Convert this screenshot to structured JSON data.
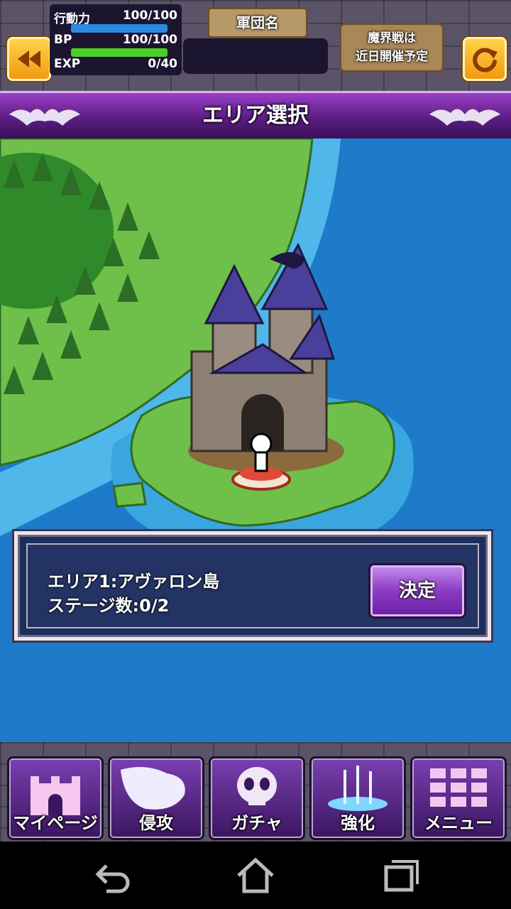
{
  "hud": {
    "stamina_label": "行動力",
    "stamina_value": "100/100",
    "stamina_fraction": 1.0,
    "bp_label": "BP",
    "bp_value": "100/100",
    "bp_fraction": 1.0,
    "exp_label": "EXP",
    "exp_value": "0/40",
    "exp_fraction": 0.0,
    "legion_label": "軍団名",
    "legion_name": "",
    "event_line1": "魔界戦は",
    "event_line2": "近日開催予定",
    "back_icon": "rewind-icon",
    "refresh_icon": "refresh-icon"
  },
  "banner": {
    "title": "エリア選択"
  },
  "area_panel": {
    "area_name": "エリア1:アヴァロン島",
    "stage_count": "ステージ数:0/2",
    "decide_label": "決定"
  },
  "nav": {
    "items": [
      {
        "label": "マイページ",
        "icon": "castle-icon"
      },
      {
        "label": "侵攻",
        "icon": "map-icon"
      },
      {
        "label": "ガチャ",
        "icon": "skull-icon"
      },
      {
        "label": "強化",
        "icon": "portal-icon"
      },
      {
        "label": "メニュー",
        "icon": "grid-icon"
      }
    ]
  },
  "system_bar": {
    "back": "back-icon",
    "home": "home-icon",
    "recents": "recents-icon"
  },
  "colors": {
    "accent": "#8a3bc2",
    "sea": "#1d7bc9",
    "land": "#6ec04a",
    "hud": "#1c1530"
  }
}
